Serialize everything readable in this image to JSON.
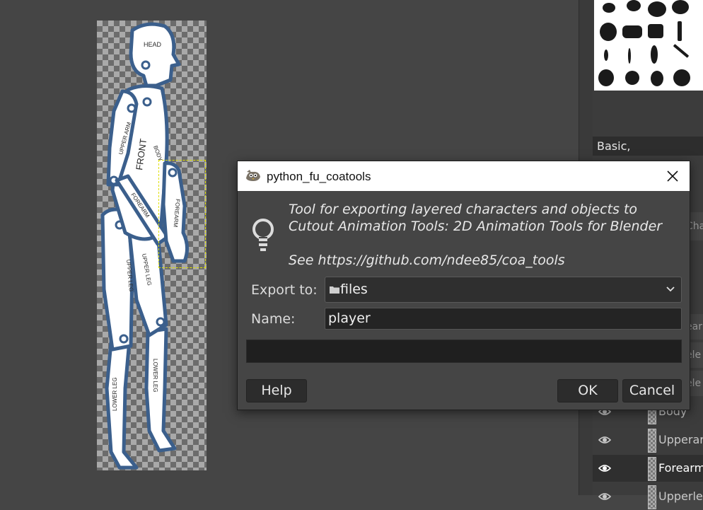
{
  "figure_labels": {
    "head": "HEAD",
    "upper_arm": "UPPER ARM",
    "front": "FRONT",
    "body": "BODY",
    "forearm_left": "FOREARM",
    "forearm_right": "FOREARM",
    "upper_leg_left": "UPPER LEG",
    "upper_leg_right": "UPPER LEG",
    "lower_leg_left": "LOWER LEG",
    "lower_leg_right": "LOWER LEG"
  },
  "dock": {
    "brush_preset": "Basic,",
    "strip_fragments": [
      "Cha",
      "earm",
      "ele",
      "ele"
    ],
    "layers": [
      {
        "name": "Body",
        "active": false
      },
      {
        "name": "Upperarm",
        "active": false
      },
      {
        "name": "Forearm",
        "active": true
      },
      {
        "name": "Upperleg",
        "active": false
      }
    ]
  },
  "dialog": {
    "title": "python_fu_coatools",
    "description_line1": "Tool for exporting layered characters and objects to",
    "description_line2": "Cutout Animation Tools: 2D Animation Tools for Blender",
    "description_line3": "See https://github.com/ndee85/coa_tools",
    "export_label": "Export to:",
    "export_value": "files",
    "name_label": "Name:",
    "name_value": "player",
    "help_label": "Help",
    "ok_label": "OK",
    "cancel_label": "Cancel"
  },
  "colors": {
    "figure_outline": "#3b5f8c",
    "figure_fill": "#ffffff",
    "dialog_bg": "#454545",
    "titlebar_bg": "#ffffff"
  }
}
